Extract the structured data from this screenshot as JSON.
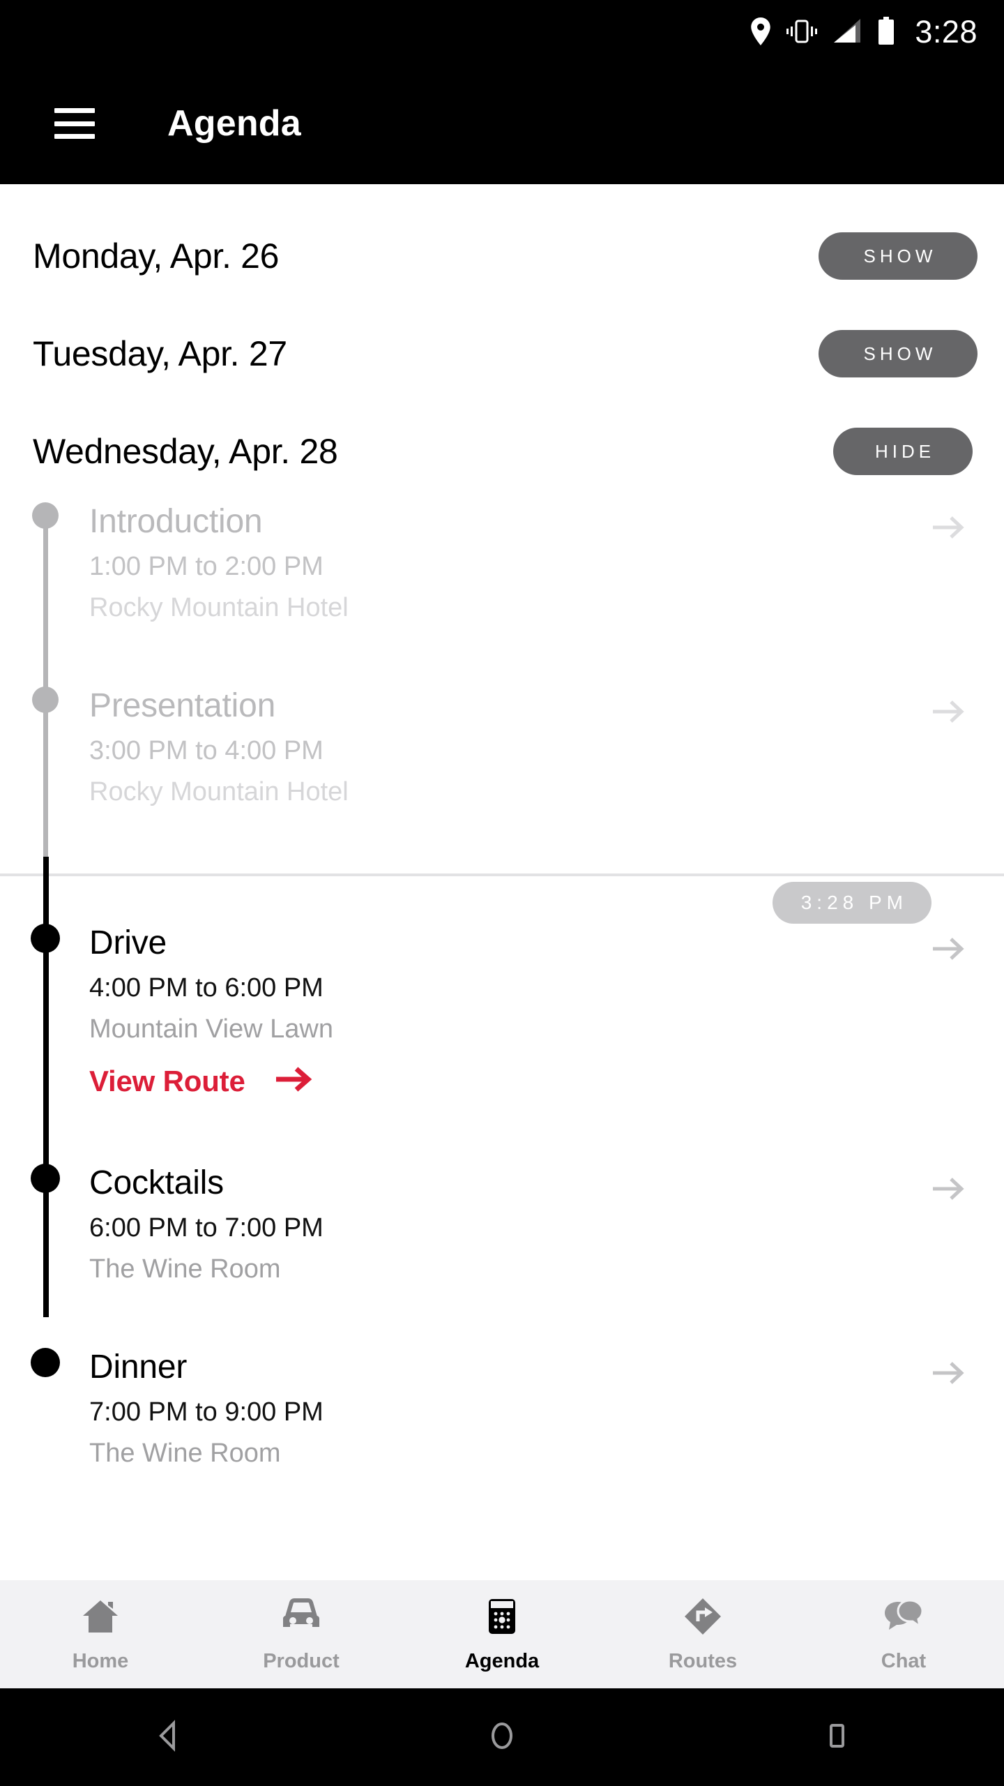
{
  "status_bar": {
    "time": "3:28",
    "icons": [
      "location-pin-icon",
      "vibrate-icon",
      "signal-icon",
      "battery-icon"
    ]
  },
  "app_bar": {
    "menu_icon": "hamburger-menu-icon",
    "title": "Agenda"
  },
  "days": [
    {
      "label": "Monday, Apr. 26",
      "toggle": "SHOW",
      "expanded": false
    },
    {
      "label": "Tuesday, Apr. 27",
      "toggle": "SHOW",
      "expanded": false
    },
    {
      "label": "Wednesday, Apr. 28",
      "toggle": "HIDE",
      "expanded": true
    }
  ],
  "now_badge": {
    "time": "3:28 PM"
  },
  "events": [
    {
      "title": "Introduction",
      "time": "1:00 PM to 2:00 PM",
      "place": "Rocky Mountain Hotel",
      "state": "past",
      "arrow": "arrow-right-icon"
    },
    {
      "title": "Presentation",
      "time": "3:00 PM to 4:00 PM",
      "place": "Rocky Mountain Hotel",
      "state": "past",
      "arrow": "arrow-right-icon"
    },
    {
      "title": "Drive",
      "time": "4:00 PM to 6:00 PM",
      "place": "Mountain View Lawn",
      "state": "current",
      "arrow": "arrow-right-icon",
      "action": {
        "label": "View Route",
        "icon": "arrow-right-icon"
      }
    },
    {
      "title": "Cocktails",
      "time": "6:00 PM to 7:00 PM",
      "place": "The Wine Room",
      "state": "current",
      "arrow": "arrow-right-icon"
    },
    {
      "title": "Dinner",
      "time": "7:00 PM to 9:00 PM",
      "place": "The Wine Room",
      "state": "current",
      "arrow": "arrow-right-icon"
    }
  ],
  "bottom_nav": [
    {
      "label": "Home",
      "icon": "home-icon",
      "active": false
    },
    {
      "label": "Product",
      "icon": "car-icon",
      "active": false
    },
    {
      "label": "Agenda",
      "icon": "calendar-icon",
      "active": true
    },
    {
      "label": "Routes",
      "icon": "route-sign-icon",
      "active": false
    },
    {
      "label": "Chat",
      "icon": "chat-bubbles-icon",
      "active": false
    }
  ],
  "android_nav": [
    {
      "icon": "back-triangle-icon"
    },
    {
      "icon": "home-circle-icon"
    },
    {
      "icon": "recents-square-icon"
    }
  ],
  "colors": {
    "accent_red": "#DC1E38",
    "pill_grey": "#666668",
    "badge_grey": "#c9c9cb",
    "past_text": "#b9b9bb",
    "nav_bg": "#f2f2f4",
    "nav_inactive": "#9a9a9c"
  }
}
